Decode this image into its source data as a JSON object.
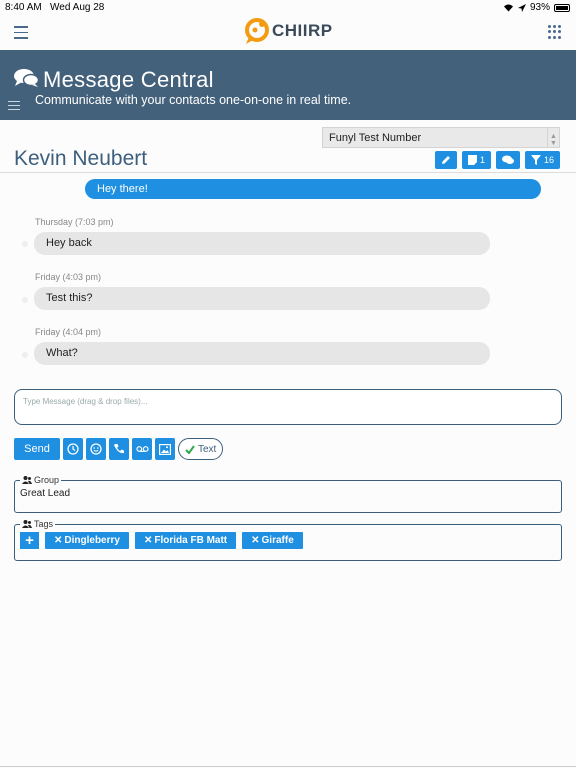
{
  "status_bar": {
    "time": "8:40 AM",
    "date": "Wed Aug 28",
    "battery": "93%"
  },
  "brand": {
    "name": "CHIIRP",
    "accent": "#f39c12"
  },
  "hero": {
    "title": "Message Central",
    "subtitle": "Communicate with your contacts one-on-one in real time.",
    "background": "#44617b"
  },
  "sender_select": {
    "selected": "Funyl Test Number"
  },
  "contact": {
    "name": "Kevin Neubert"
  },
  "actions": {
    "notes_count": "1",
    "filter_count": "16"
  },
  "messages": [
    {
      "direction": "outgoing",
      "text": "Hey there!"
    },
    {
      "direction": "incoming",
      "time": "Thursday (7:03 pm)",
      "text": "Hey back"
    },
    {
      "direction": "incoming",
      "time": "Friday (4:03 pm)",
      "text": "Test this?"
    },
    {
      "direction": "incoming",
      "time": "Friday (4:04 pm)",
      "text": "What?"
    }
  ],
  "compose": {
    "placeholder": "Type Message (drag & drop files)..."
  },
  "toolbar": {
    "send_label": "Send",
    "text_toggle_label": "Text"
  },
  "group": {
    "legend": "Group",
    "value": "Great Lead"
  },
  "tags": {
    "legend": "Tags",
    "items": [
      "Dingleberry",
      "Florida FB Matt",
      "Giraffe"
    ]
  },
  "colors": {
    "primary": "#1e8fe1",
    "dark": "#3d5f7e"
  }
}
